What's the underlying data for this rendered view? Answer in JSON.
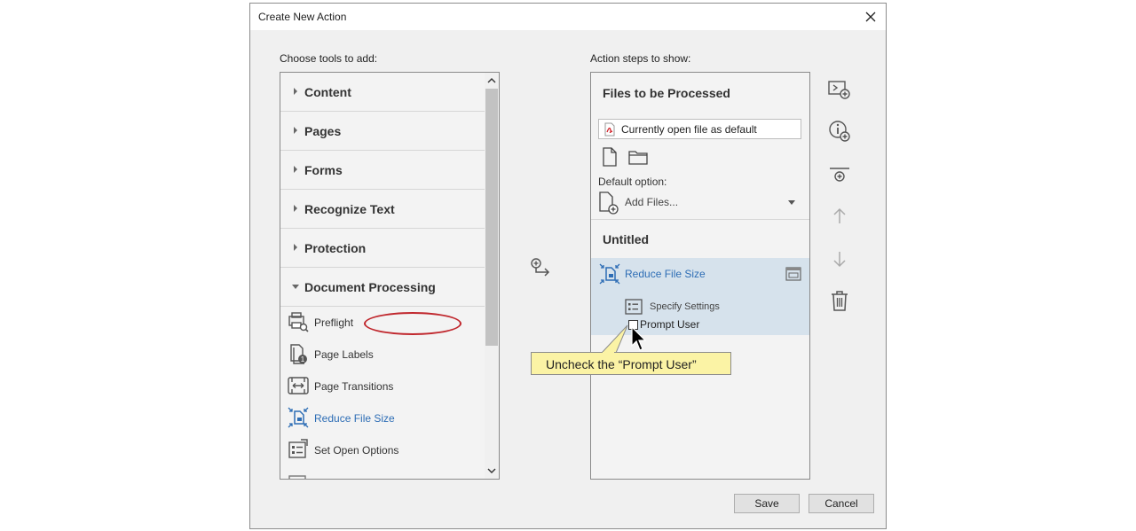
{
  "window": {
    "title": "Create New Action"
  },
  "labels": {
    "choose_tools": "Choose tools to add:",
    "action_steps": "Action steps to show:"
  },
  "tools": {
    "categories": [
      "Content",
      "Pages",
      "Forms",
      "Recognize Text",
      "Protection",
      "Document Processing"
    ],
    "expanded_category": "Document Processing",
    "items": [
      "Preflight",
      "Page Labels",
      "Page Transitions",
      "Reduce File Size",
      "Set Open Options"
    ],
    "active_item": "Reduce File Size"
  },
  "steps": {
    "files_heading": "Files to be Processed",
    "current_file": "Currently open file as default",
    "default_option_label": "Default option:",
    "add_files": "Add Files...",
    "untitled_heading": "Untitled",
    "step_title": "Reduce File Size",
    "specify_settings": "Specify Settings",
    "prompt_user": "Prompt User",
    "prompt_user_checked": false
  },
  "callout": {
    "text": "Uncheck the “Prompt User”"
  },
  "buttons": {
    "save": "Save",
    "cancel": "Cancel"
  },
  "colors": {
    "accent": "#2d6db5",
    "highlight": "#c0272d",
    "callout_bg": "#fbf3a5",
    "selected_step_bg": "#d6e2ec"
  }
}
